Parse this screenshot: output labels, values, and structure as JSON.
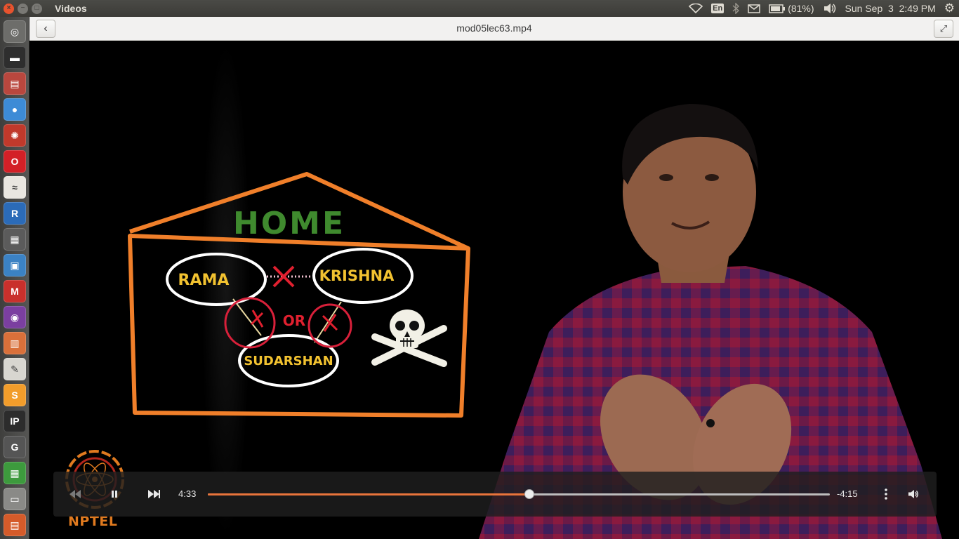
{
  "window": {
    "title": "Videos",
    "close_glyph": "×",
    "minimize_glyph": "−",
    "maximize_glyph": "□"
  },
  "indicators": {
    "keyboard": "En",
    "battery": "(81%)",
    "clock": "Sun Sep  3  2:49 PM"
  },
  "header": {
    "filename": "mod05lec63.mp4"
  },
  "video": {
    "drawing": {
      "home_label": "HOME",
      "node_rama": "RAMA",
      "node_krishna": "KRISHNA",
      "node_sudarshan": "SUDARSHAN",
      "or_label": "OR",
      "colors": {
        "frame": "#f07f2a",
        "home_text": "#3f8a2e",
        "node_text": "#f2c230",
        "cross": "#e0202f",
        "ellipse": "#ffffff"
      }
    },
    "logo_text": "NPTEL"
  },
  "controls": {
    "elapsed": "4:33",
    "remaining": "-4:15",
    "progress_fraction": 0.517,
    "accent": "#e8743b"
  },
  "launcher": {
    "items": [
      {
        "name": "dash-home-icon",
        "glyph": "◎",
        "color": "#6d6d6a"
      },
      {
        "name": "terminal-icon",
        "glyph": "▬",
        "color": "#2e2e2e"
      },
      {
        "name": "file-archive-icon",
        "glyph": "▤",
        "color": "#b9473e"
      },
      {
        "name": "chrome-icon",
        "glyph": "●",
        "color": "#3d8bd6"
      },
      {
        "name": "settings-wheel-icon",
        "glyph": "✺",
        "color": "#c0392b"
      },
      {
        "name": "opera-icon",
        "glyph": "O",
        "color": "#d32027"
      },
      {
        "name": "document-viewer-icon",
        "glyph": "≈",
        "color": "#e9e6e0"
      },
      {
        "name": "r-language-icon",
        "glyph": "R",
        "color": "#2b6bb8"
      },
      {
        "name": "video-editor-icon",
        "glyph": "▦",
        "color": "#5b5b5b"
      },
      {
        "name": "image-viewer-icon",
        "glyph": "▣",
        "color": "#3b82c4"
      },
      {
        "name": "gmail-icon",
        "glyph": "M",
        "color": "#c9302c"
      },
      {
        "name": "media-player-icon",
        "glyph": "◉",
        "color": "#7b3fa0"
      },
      {
        "name": "presentation-icon",
        "glyph": "▥",
        "color": "#d9703a"
      },
      {
        "name": "text-editor-icon",
        "glyph": "✎",
        "color": "#d8d6d0"
      },
      {
        "name": "sublime-icon",
        "glyph": "S",
        "color": "#f29d2b"
      },
      {
        "name": "ipython-icon",
        "glyph": "IP",
        "color": "#2c2c2c"
      },
      {
        "name": "geogebra-icon",
        "glyph": "G",
        "color": "#555555"
      },
      {
        "name": "spreadsheet-icon",
        "glyph": "▦",
        "color": "#3d9a3d"
      },
      {
        "name": "drive-icon",
        "glyph": "▭",
        "color": "#8a8a87"
      },
      {
        "name": "software-center-icon",
        "glyph": "▤",
        "color": "#d55b2a"
      }
    ]
  }
}
